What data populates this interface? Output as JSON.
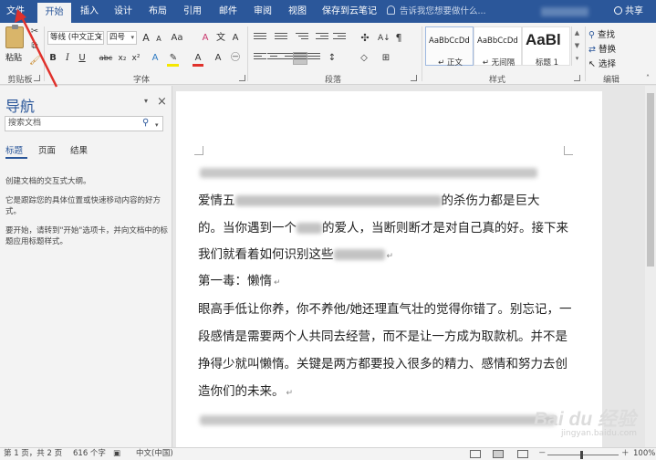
{
  "ribbon_tabs": [
    {
      "label": "文件"
    },
    {
      "label": "开始",
      "active": true
    },
    {
      "label": "插入"
    },
    {
      "label": "设计"
    },
    {
      "label": "布局"
    },
    {
      "label": "引用"
    },
    {
      "label": "邮件"
    },
    {
      "label": "审阅"
    },
    {
      "label": "视图"
    },
    {
      "label": "保存到云笔记"
    }
  ],
  "tell_me": "告诉我您想要做什么...",
  "share": "共享",
  "clipboard": {
    "paste": "粘贴",
    "group": "剪贴板"
  },
  "font": {
    "name": "等线 (中文正文)",
    "size": "四号",
    "group": "字体",
    "bold": "B",
    "italic": "I",
    "underline": "U",
    "strike": "abc",
    "subscript": "x₂",
    "superscript": "x²",
    "grow": "A",
    "shrink": "A",
    "case": "Aa",
    "clear": "A"
  },
  "paragraph": {
    "group": "段落"
  },
  "styles": {
    "group": "样式",
    "items": [
      {
        "sample": "AaBbCcDd",
        "name": "↵ 正文"
      },
      {
        "sample": "AaBbCcDd",
        "name": "↵ 无间隔"
      },
      {
        "sample": "AaBl",
        "name": "标题 1"
      }
    ]
  },
  "editing": {
    "find": "查找",
    "replace": "替换",
    "select": "选择",
    "group": "编辑"
  },
  "nav": {
    "title": "导航",
    "search_placeholder": "搜索文档",
    "tabs": [
      "标题",
      "页面",
      "结果"
    ],
    "text1": "创建文档的交互式大纲。",
    "text2": "它是跟踪您的具体位置或快速移动内容的好方式。",
    "text3": "要开始，请转到\"开始\"选项卡，并向文档中的标题应用标题样式。"
  },
  "document": {
    "line2_start": "爱情五",
    "line2_end": "的杀伤力都是巨大",
    "line3_a": "的。当你遇到一个",
    "line3_b": "的爱人，当断则断才是对自己真的好。接下来",
    "line4": "我们就看着如何识别这些",
    "heading": "第一毒：懒惰",
    "p1": "眼高手低让你养，你不养他/她还理直气壮的觉得你错了。别忘记，一",
    "p2": "段感情是需要两个人共同去经营，而不是让一方成为取款机。并不是",
    "p3": "挣得少就叫懒惰。关键是两方都要投入很多的精力、感情和努力去创",
    "p4": "造你们的未来。",
    "para_mark": "↵"
  },
  "watermark": {
    "brand": "Bai du 经验",
    "sub": "jingyan.baidu.com"
  },
  "status": {
    "page": "第 1 页，共 2 页",
    "words": "616 个字",
    "language": "中文(中国)",
    "zoom": "100%",
    "zoom_minus": "－",
    "zoom_plus": "＋"
  },
  "colors": {
    "brand": "#2b579a",
    "annotation": "#e0312b"
  }
}
